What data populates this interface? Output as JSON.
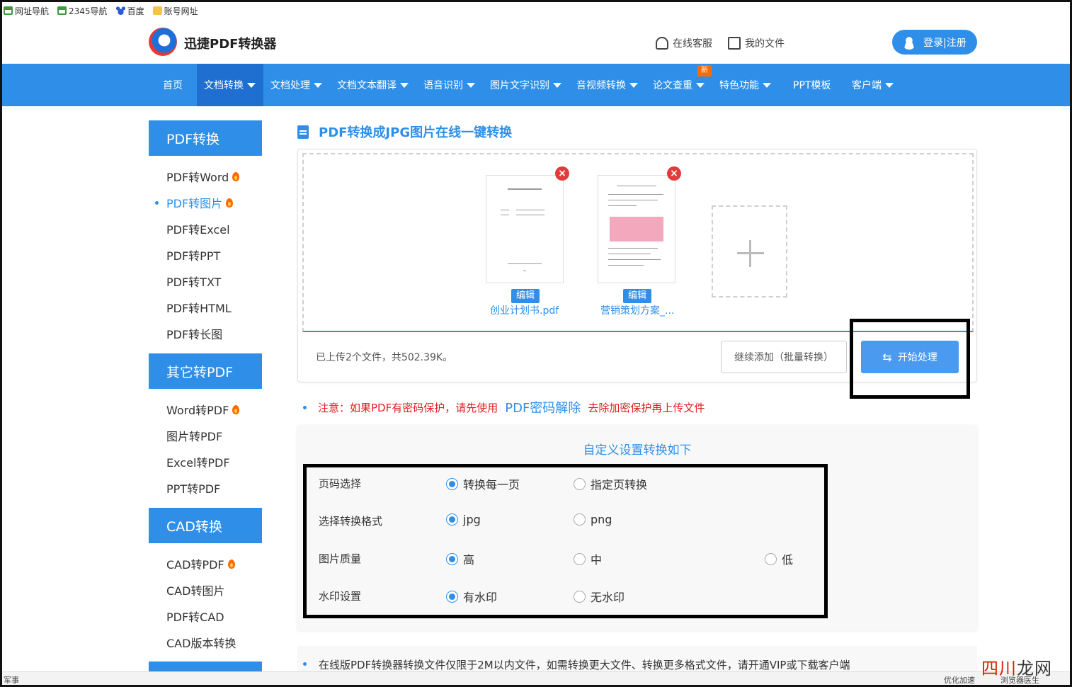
{
  "bookmarks": [
    {
      "label": "网址导航",
      "icon": "house-icon"
    },
    {
      "label": "2345导航",
      "icon": "house-icon"
    },
    {
      "label": "百度",
      "icon": "paw-icon"
    },
    {
      "label": "账号网址",
      "icon": "folder-icon"
    }
  ],
  "header": {
    "brand": "迅捷PDF转换器",
    "service_link": "在线客服",
    "my_files_link": "我的文件",
    "login_label": "登录|注册"
  },
  "nav": {
    "items": [
      "首页",
      "文档转换",
      "文档处理",
      "文档文本翻译",
      "语音识别",
      "图片文字识别",
      "音视频转换",
      "论文查重",
      "特色功能",
      "PPT模板",
      "客户端"
    ],
    "active_index": 1,
    "new_badge": "新"
  },
  "sidebar": {
    "groups": [
      {
        "title": "PDF转换",
        "items": [
          "PDF转Word",
          "PDF转图片",
          "PDF转Excel",
          "PDF转PPT",
          "PDF转TXT",
          "PDF转HTML",
          "PDF转长图"
        ]
      },
      {
        "title": "其它转PDF",
        "items": [
          "Word转PDF",
          "图片转PDF",
          "Excel转PDF",
          "PPT转PDF"
        ]
      },
      {
        "title": "CAD转换",
        "items": [
          "CAD转PDF",
          "CAD转图片",
          "PDF转CAD",
          "CAD版本转换"
        ]
      }
    ],
    "active_item": "PDF转图片"
  },
  "main": {
    "title": "PDF转换成JPG图片在线一键转换",
    "files": [
      {
        "name": "创业计划书.pdf",
        "edit_label": "编辑"
      },
      {
        "name": "营销策划方案_...",
        "edit_label": "编辑"
      }
    ],
    "upload_status": "已上传2个文件，共502.39K。",
    "batch_add_label": "继续添加（批量转换）",
    "start_label": "开始处理"
  },
  "notice": {
    "prefix": "注意：如果PDF有密码保护，请先使用",
    "link": "PDF密码解除",
    "suffix": "去除加密保护再上传文件"
  },
  "settings": {
    "title": "自定义设置转换如下",
    "rows": [
      {
        "label": "页码选择",
        "options": [
          "转换每一页",
          "指定页转换"
        ],
        "selected": 0
      },
      {
        "label": "选择转换格式",
        "options": [
          "jpg",
          "png"
        ],
        "selected": 0
      },
      {
        "label": "图片质量",
        "options": [
          "高",
          "中",
          "低"
        ],
        "selected": 0
      },
      {
        "label": "水印设置",
        "options": [
          "有水印",
          "无水印"
        ],
        "selected": 0
      }
    ]
  },
  "footer_note": "在线版PDF转换器转换文件仅限于2M以内文件，如需转换更大文件、转换更多格式文件，请开通VIP或下载客户端",
  "statusbar": {
    "left": "军事",
    "right1": "优化加速",
    "right2": "浏览器医生"
  },
  "watermark": {
    "red": "四川",
    "dark": "龙网"
  },
  "colors": {
    "primary": "#2f8fe8",
    "nav_active": "#1e6fd0",
    "danger": "#e02020",
    "badge": "#ff6a00"
  }
}
